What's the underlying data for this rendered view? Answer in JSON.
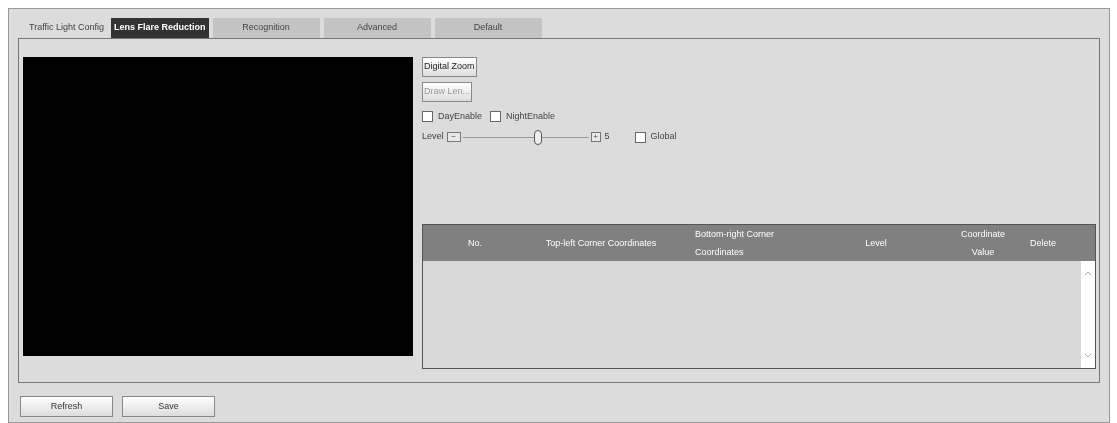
{
  "tabs": [
    {
      "label": "Traffic Light Config",
      "selected": false
    },
    {
      "label": "Lens Flare Reduction",
      "selected": true
    },
    {
      "label": "Recognition",
      "selected": false
    },
    {
      "label": "Advanced",
      "selected": false
    },
    {
      "label": "Default",
      "selected": false
    }
  ],
  "tool_buttons": [
    {
      "label": "Digital Zoom",
      "disabled": false
    },
    {
      "label": "Draw Len...",
      "disabled": true
    }
  ],
  "checkboxes": [
    {
      "label": "DayEnable",
      "checked": false
    },
    {
      "label": "NightEnable",
      "checked": false
    }
  ],
  "level": {
    "label": "Level",
    "minus": "−",
    "plus": "+",
    "level": 0.6,
    "reading": "5"
  },
  "global": {
    "label": "Global",
    "checked": false
  },
  "table": {
    "columns": [
      "No.",
      "Top-left Corner Coordinates",
      "Bottom-right Corner Coordinates",
      "Level",
      "Coordinate Value",
      "Delete"
    ]
  },
  "buttons": [
    "Refresh",
    "Save"
  ]
}
